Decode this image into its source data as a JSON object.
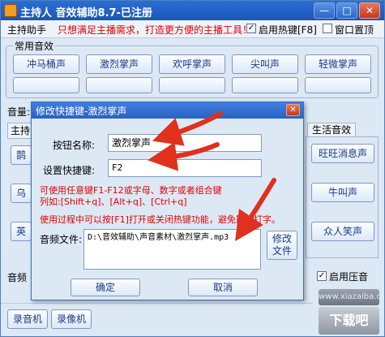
{
  "window": {
    "title": "主持人 音效辅助8.7-已注册",
    "min_glyph": "—",
    "max_glyph": "□",
    "close_glyph": "✕"
  },
  "toolbar": {
    "tab_host": "主持助手",
    "notice": "只想满足主播需求，打造更方便的主播工具！",
    "hotkey_label": "启用热键[F8]",
    "hotkey_checked": "✓",
    "top_label": "窗口置顶",
    "top_checked": ""
  },
  "common": {
    "label": "常用音效",
    "row1": [
      "冲马桶声",
      "激烈掌声",
      "欢呼掌声",
      "尖叫声",
      "轻微掌声"
    ],
    "row2": [
      "",
      "",
      "",
      "",
      ""
    ]
  },
  "main": {
    "volume_label": "音量:",
    "host_tab": "主持",
    "life_tab": "生活音效",
    "life_buttons": [
      "旺旺消息声",
      "牛叫声",
      "众人笑声"
    ],
    "left_partial": [
      "鹊",
      "乌",
      "英"
    ],
    "audio_tag": "音频",
    "compress_label": "启用压音",
    "compress_checked": "✓",
    "record_audio": "录音机",
    "record_video": "录像机",
    "watermark_small": "www.xiazaiba.com",
    "watermark_big": "下载吧"
  },
  "dialog": {
    "title": "修改快捷键-激烈掌声",
    "close_glyph": "✕",
    "name_label": "按钮名称:",
    "name_value": "激烈掌声",
    "hotkey_label": "设置快捷键:",
    "hotkey_value": "F2",
    "hint1": "可使用任意键F1-F12或字母、数字或者组合键",
    "hint2": "列如:[Shift+q]、[Alt+q]、[Ctrl+q]",
    "hint3": "使用过程中可以按[F1]打开或关闭热键功能，避免影响打字。",
    "file_label": "音频文件:",
    "file_value": "D:\\音效辅助\\声音素材\\激烈掌声.mp3",
    "modify_button": "修改\n文件",
    "ok_button": "确定",
    "cancel_button": "取消"
  },
  "colors": {
    "titlebar": "#1c55b7",
    "window_bg": "#dde8f5",
    "notice_red": "#e00000",
    "arrow_red": "#e0301e"
  }
}
